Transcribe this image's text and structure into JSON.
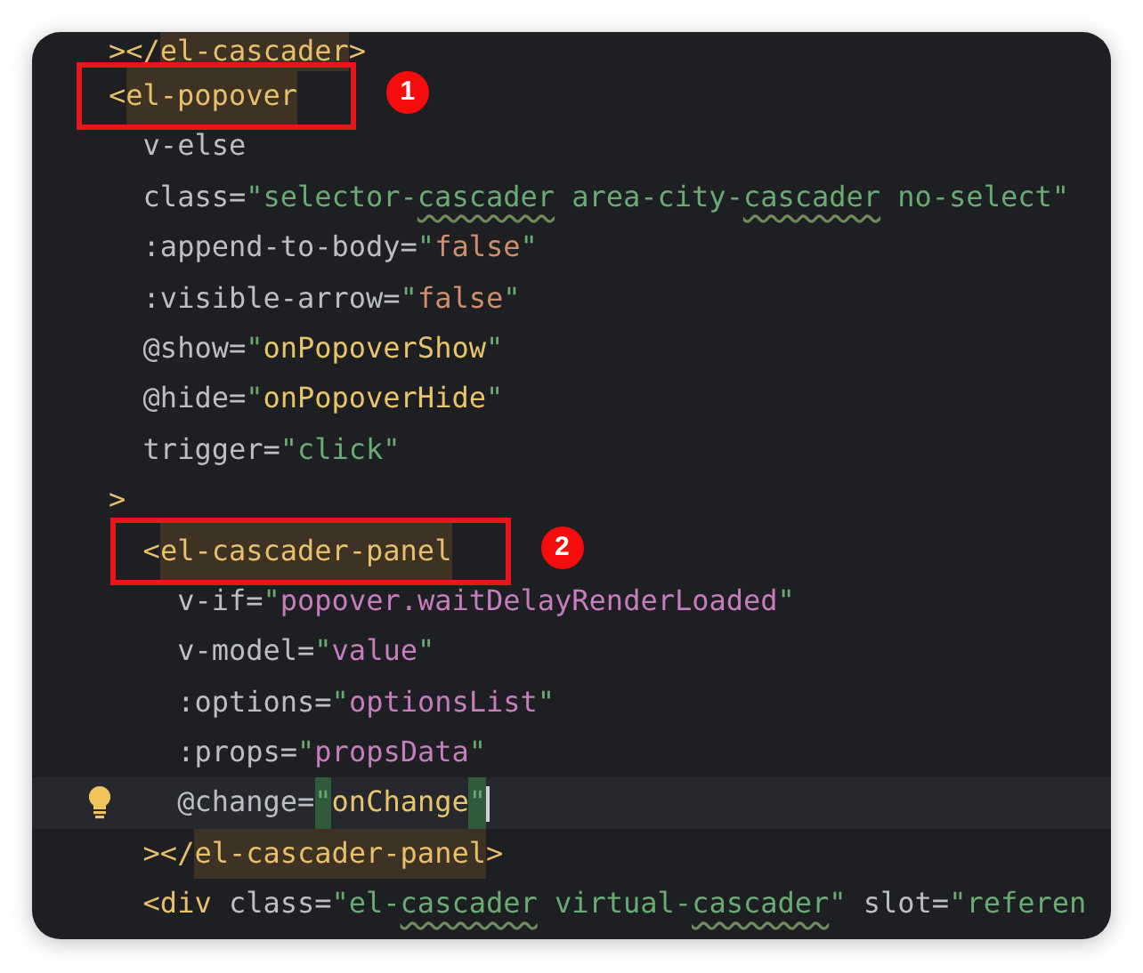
{
  "editor": {
    "lines": [
      {
        "tokens": [
          {
            "kind": "tag",
            "text": "></"
          },
          {
            "kind": "tagmatch",
            "text": "el-cascader"
          },
          {
            "kind": "tag",
            "text": ">"
          }
        ]
      },
      {
        "callout": "1",
        "tokens": [
          {
            "kind": "tag",
            "text": "<"
          },
          {
            "kind": "tagmatch",
            "text": "el-popover"
          }
        ],
        "children": [
          {
            "tokens": [
              {
                "kind": "attr",
                "text": "v-else"
              }
            ]
          },
          {
            "tokens": [
              {
                "kind": "attr",
                "text": "class="
              },
              {
                "kind": "str",
                "text": "\"selector-"
              },
              {
                "kind": "typo",
                "text": "cascader"
              },
              {
                "kind": "str",
                "text": " area-city-"
              },
              {
                "kind": "typo",
                "text": "cascader"
              },
              {
                "kind": "str",
                "text": " no-select\""
              }
            ]
          },
          {
            "tokens": [
              {
                "kind": "attr",
                "text": ":append-to-body="
              },
              {
                "kind": "str",
                "text": "\""
              },
              {
                "kind": "bool",
                "text": "false"
              },
              {
                "kind": "str",
                "text": "\""
              }
            ]
          },
          {
            "tokens": [
              {
                "kind": "attr",
                "text": ":visible-arrow="
              },
              {
                "kind": "str",
                "text": "\""
              },
              {
                "kind": "bool",
                "text": "false"
              },
              {
                "kind": "str",
                "text": "\""
              }
            ]
          },
          {
            "tokens": [
              {
                "kind": "attr",
                "text": "@show="
              },
              {
                "kind": "str",
                "text": "\""
              },
              {
                "kind": "method",
                "text": "onPopoverShow"
              },
              {
                "kind": "str",
                "text": "\""
              }
            ]
          },
          {
            "tokens": [
              {
                "kind": "attr",
                "text": "@hide="
              },
              {
                "kind": "str",
                "text": "\""
              },
              {
                "kind": "method",
                "text": "onPopoverHide"
              },
              {
                "kind": "str",
                "text": "\""
              }
            ]
          },
          {
            "tokens": [
              {
                "kind": "attr",
                "text": "trigger="
              },
              {
                "kind": "str",
                "text": "\"click\""
              }
            ]
          }
        ]
      },
      {
        "tokens": [
          {
            "kind": "tag",
            "text": ">"
          }
        ],
        "children": [
          {
            "callout": "2",
            "tokens": [
              {
                "kind": "tag",
                "text": "<"
              },
              {
                "kind": "tagmatch",
                "text": "el-cascader-panel"
              }
            ],
            "children": [
              {
                "tokens": [
                  {
                    "kind": "attr",
                    "text": "v-if="
                  },
                  {
                    "kind": "str",
                    "text": "\""
                  },
                  {
                    "kind": "expr",
                    "text": "popover.waitDelayRenderLoaded"
                  },
                  {
                    "kind": "str",
                    "text": "\""
                  }
                ]
              },
              {
                "tokens": [
                  {
                    "kind": "attr",
                    "text": "v-model="
                  },
                  {
                    "kind": "str",
                    "text": "\""
                  },
                  {
                    "kind": "expr",
                    "text": "value"
                  },
                  {
                    "kind": "str",
                    "text": "\""
                  }
                ]
              },
              {
                "tokens": [
                  {
                    "kind": "attr",
                    "text": ":options="
                  },
                  {
                    "kind": "str",
                    "text": "\""
                  },
                  {
                    "kind": "expr",
                    "text": "optionsList"
                  },
                  {
                    "kind": "str",
                    "text": "\""
                  }
                ]
              },
              {
                "tokens": [
                  {
                    "kind": "attr",
                    "text": ":props="
                  },
                  {
                    "kind": "str",
                    "text": "\""
                  },
                  {
                    "kind": "expr",
                    "text": "propsData"
                  },
                  {
                    "kind": "str",
                    "text": "\""
                  }
                ]
              },
              {
                "current": true,
                "tokens": [
                  {
                    "kind": "attr",
                    "text": "@change="
                  },
                  {
                    "kind": "quotematch",
                    "text": "\""
                  },
                  {
                    "kind": "method",
                    "text": "onChange"
                  },
                  {
                    "kind": "quotematch",
                    "text": "\""
                  }
                ]
              }
            ]
          },
          {
            "tokens": [
              {
                "kind": "tag",
                "text": "></"
              },
              {
                "kind": "tagmatch",
                "text": "el-cascader-panel"
              },
              {
                "kind": "tag",
                "text": ">"
              }
            ]
          },
          {
            "tokens": [
              {
                "kind": "tag",
                "text": "<div"
              },
              {
                "kind": "attr",
                "text": " class="
              },
              {
                "kind": "str",
                "text": "\"el-"
              },
              {
                "kind": "typo",
                "text": "cascader"
              },
              {
                "kind": "str",
                "text": " virtual-"
              },
              {
                "kind": "typo",
                "text": "cascader"
              },
              {
                "kind": "str",
                "text": "\""
              },
              {
                "kind": "attr",
                "text": " slot="
              },
              {
                "kind": "str",
                "text": "\"referen"
              }
            ]
          }
        ]
      }
    ]
  }
}
